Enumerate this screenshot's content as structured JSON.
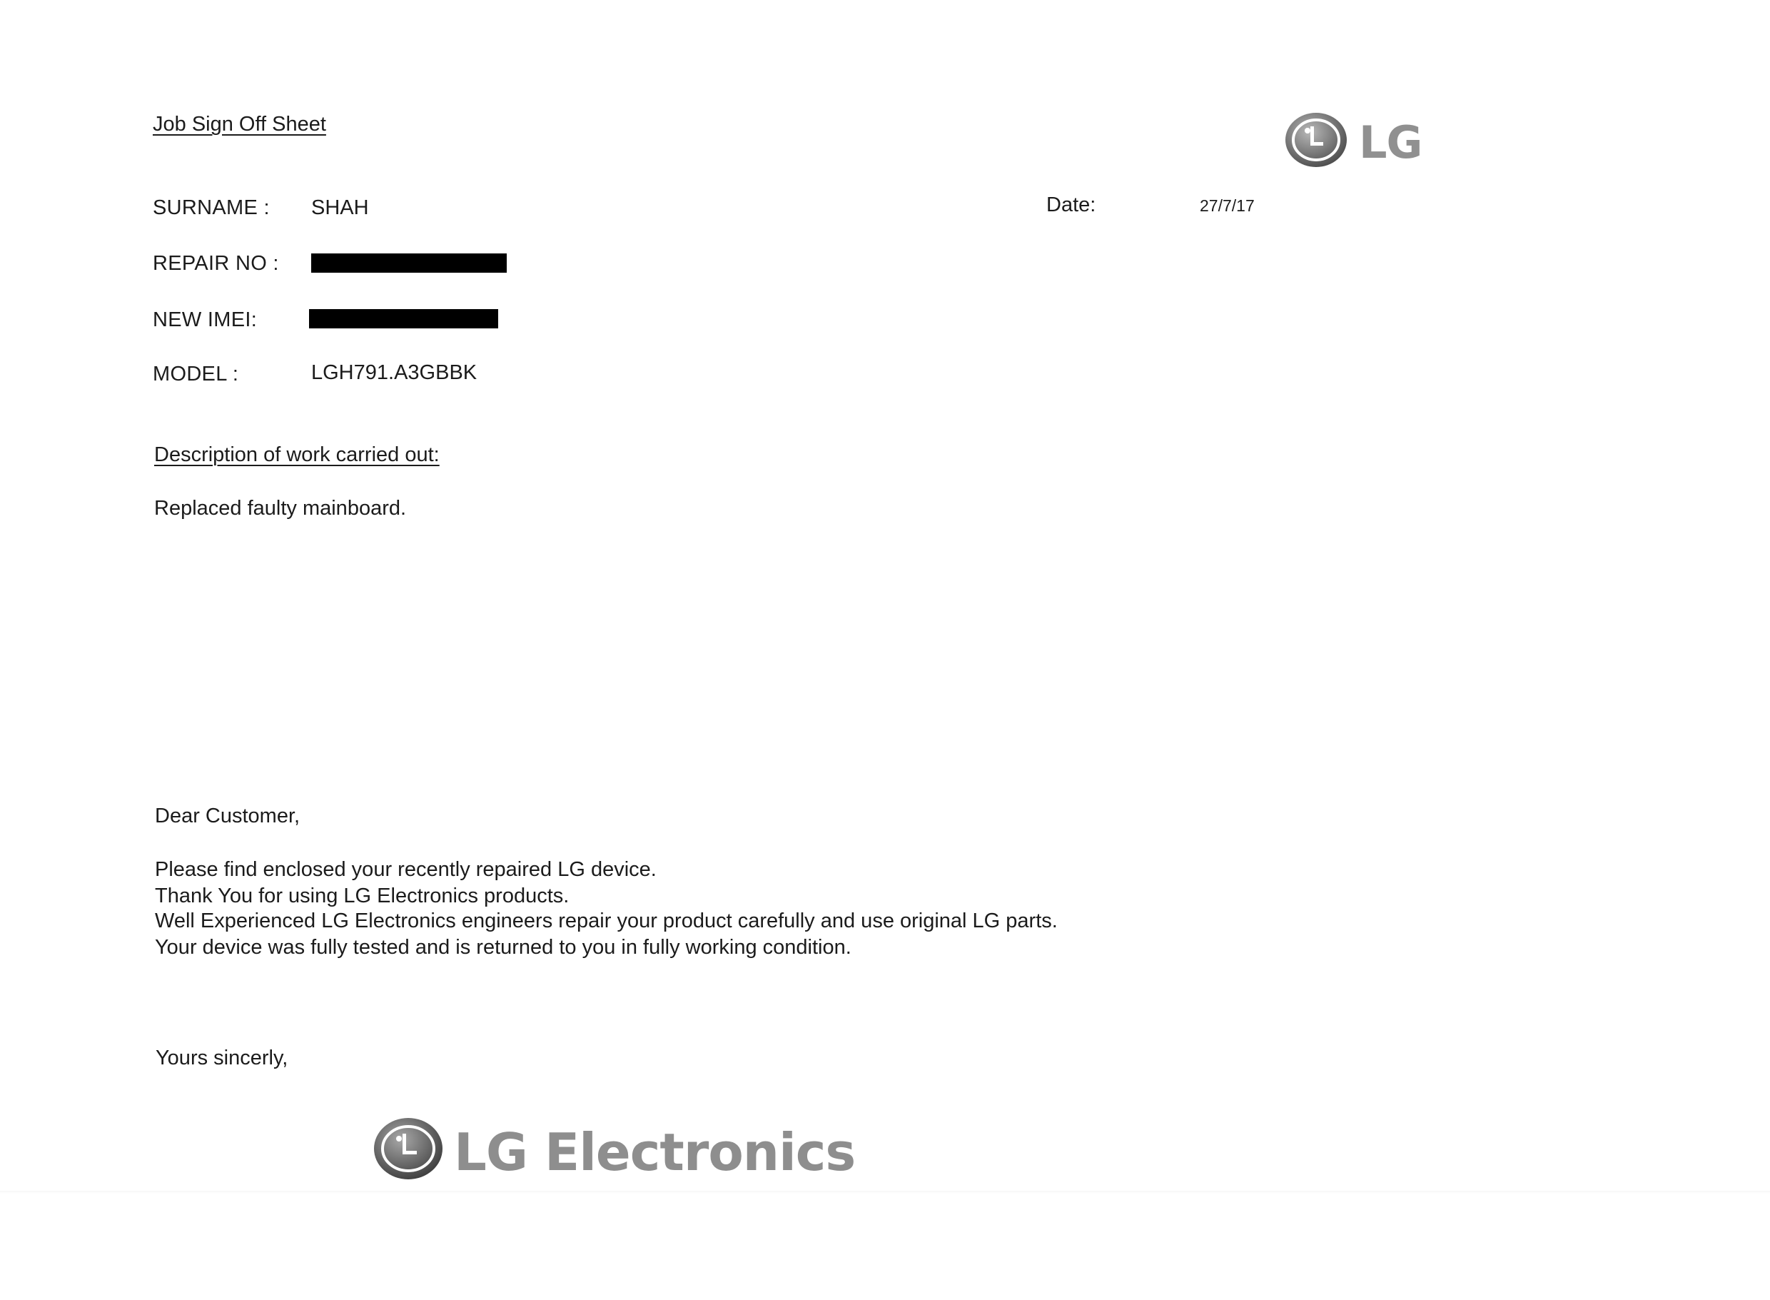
{
  "document": {
    "title": "Job Sign Off Sheet",
    "fields": {
      "surname_label": "SURNAME :",
      "surname_value": "SHAH",
      "repair_no_label": "REPAIR NO :",
      "new_imei_label": "NEW IMEI:",
      "model_label": "MODEL :",
      "model_value": "LGH791.A3GBBK",
      "date_label": "Date:",
      "date_value": "27/7/17"
    },
    "description_heading": "Description of work carried out:",
    "description_text": "Replaced faulty mainboard.",
    "letter": {
      "greeting": "Dear Customer,",
      "lines": [
        "Please find enclosed your recently repaired LG device.",
        "Thank You for using LG Electronics products.",
        "Well Experienced LG Electronics engineers repair your product carefully and use original LG parts.",
        "Your device was fully tested and is returned to you in fully working condition."
      ],
      "closing": "Yours sincerly,"
    },
    "logos": {
      "header_logo_text": "LG",
      "signature_logo_text": "LG Electronics"
    },
    "colors": {
      "ink": "#1b1b1b",
      "logo_gray": "#8b8b8b",
      "redaction": "#000000"
    }
  }
}
